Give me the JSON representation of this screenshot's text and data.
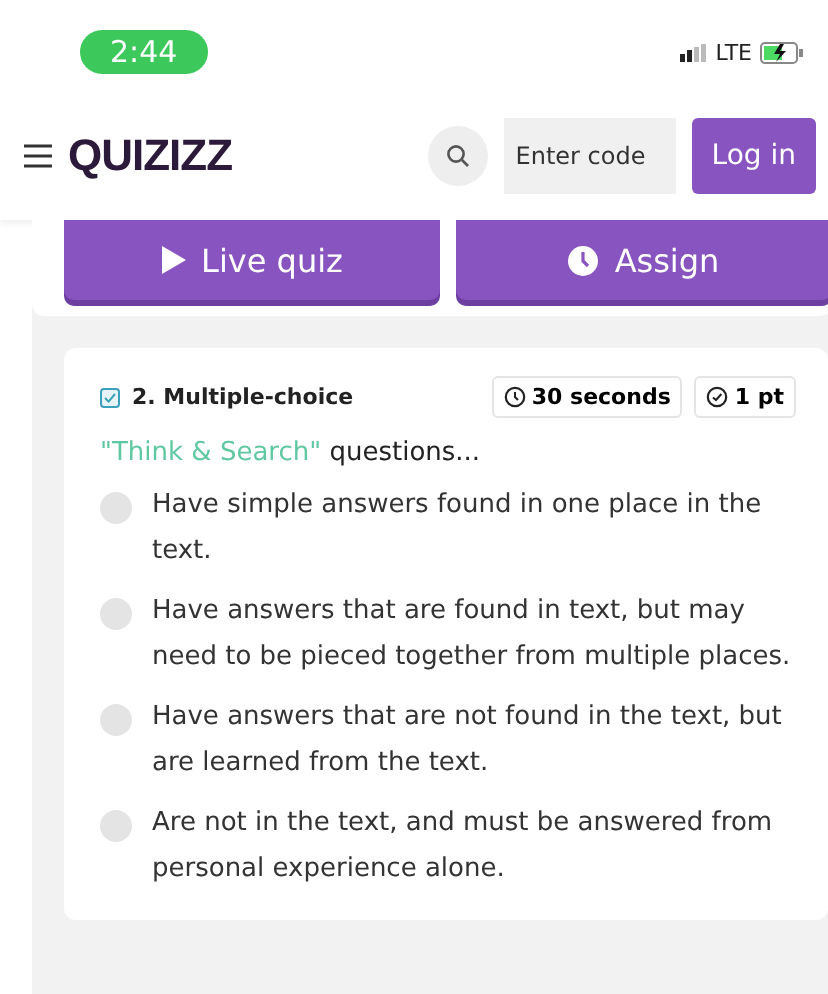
{
  "status_bar": {
    "time": "2:44",
    "network": "LTE"
  },
  "header": {
    "logo": "QUIZIZZ",
    "code_field": {
      "placeholder": "Enter code"
    },
    "login": "Log in"
  },
  "actions": [
    "Live quiz",
    "Assign"
  ],
  "question": {
    "type": "2. Multiple-choice",
    "time": "30 seconds",
    "points": "1 pt",
    "highlight": "\"Think & Search\"",
    "text": " questions...",
    "options": [
      {
        "text": "Have simple answers found in one place in the text.",
        "selected": false
      },
      {
        "text": "Have answers that are found in text, but may need to be pieced together from multiple places.",
        "selected": false
      },
      {
        "text": "Have answers that are not found in the text, but are learned from the text.",
        "selected": false
      },
      {
        "text": "Are not in the text, and must be answered from personal experience alone.",
        "selected": false
      }
    ]
  }
}
